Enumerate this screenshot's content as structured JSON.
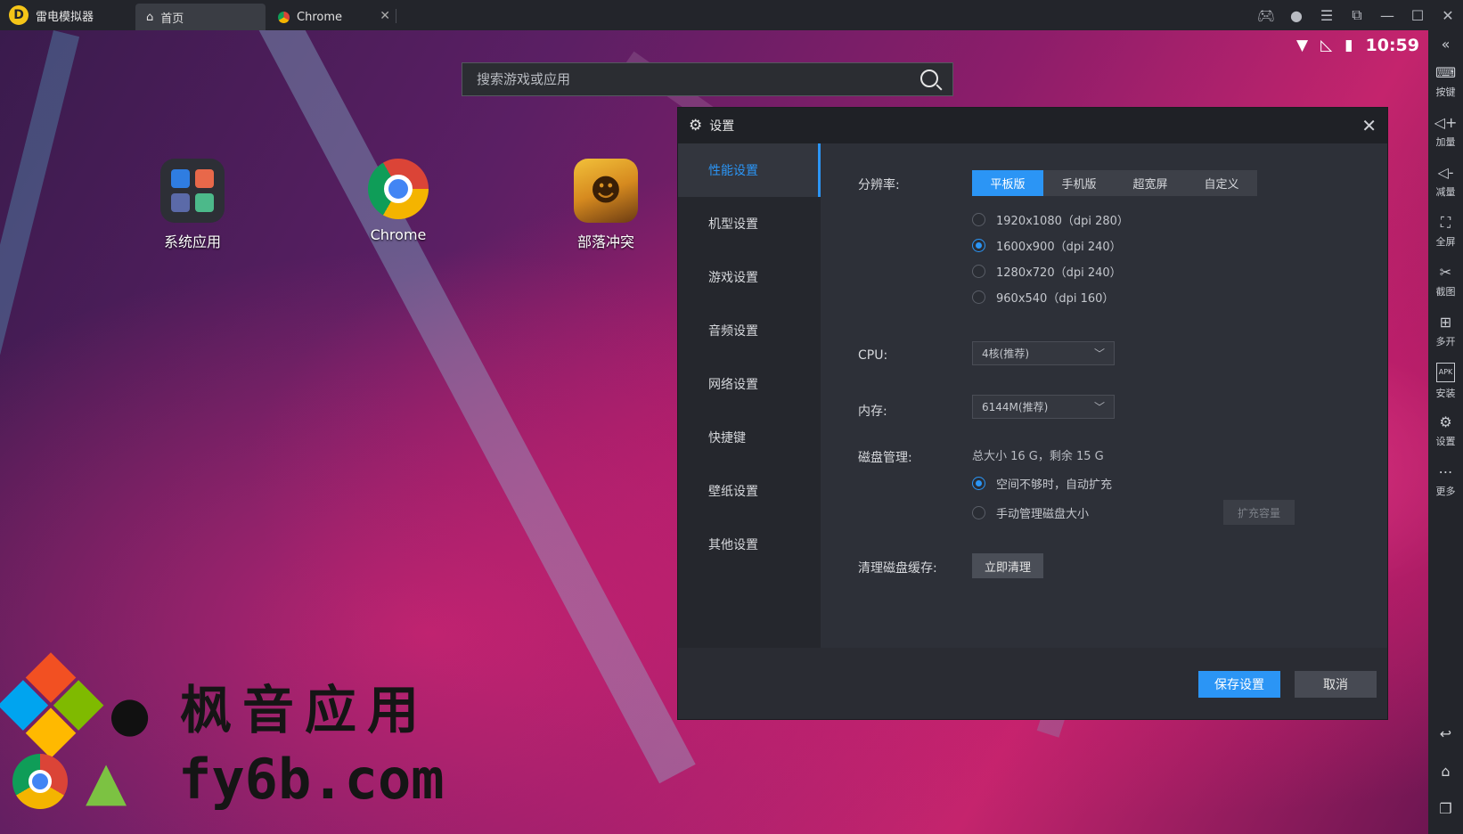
{
  "app": {
    "name": "雷电模拟器",
    "logo_icon": "lightning-logo-icon"
  },
  "tabs": [
    {
      "label": "首页",
      "icon": "home-icon"
    },
    {
      "label": "Chrome",
      "icon": "chrome-icon"
    }
  ],
  "window_controls": [
    "gamepad-icon",
    "user-icon",
    "menu-icon",
    "pip-icon",
    "minimize-icon",
    "maximize-icon",
    "close-icon"
  ],
  "status": {
    "time": "10:59"
  },
  "search": {
    "placeholder": "搜索游戏或应用"
  },
  "desktop_apps": [
    {
      "label": "系统应用"
    },
    {
      "label": "Chrome"
    },
    {
      "label": "部落冲突"
    }
  ],
  "watermark": {
    "line1": "枫音应用",
    "line2": "fy6b.com"
  },
  "sidebar": {
    "items": [
      {
        "label": "按键",
        "icon": "keyboard-icon"
      },
      {
        "label": "加量",
        "icon": "volume-up-icon"
      },
      {
        "label": "减量",
        "icon": "volume-down-icon"
      },
      {
        "label": "全屏",
        "icon": "fullscreen-icon"
      },
      {
        "label": "截图",
        "icon": "scissors-icon"
      },
      {
        "label": "多开",
        "icon": "multi-instance-icon"
      },
      {
        "label": "安装",
        "icon": "apk-icon"
      },
      {
        "label": "设置",
        "icon": "gear-icon"
      },
      {
        "label": "更多",
        "icon": "more-icon"
      }
    ]
  },
  "dialog": {
    "title": "设置",
    "nav": [
      "性能设置",
      "机型设置",
      "游戏设置",
      "音频设置",
      "网络设置",
      "快捷键",
      "壁纸设置",
      "其他设置"
    ],
    "active_nav": "性能设置",
    "resolution": {
      "label": "分辨率:",
      "modes": [
        "平板版",
        "手机版",
        "超宽屏",
        "自定义"
      ],
      "selected_mode": "平板版",
      "options": [
        "1920x1080（dpi 280）",
        "1600x900（dpi 240）",
        "1280x720（dpi 240）",
        "960x540（dpi 160）"
      ],
      "selected_option": "1600x900（dpi 240）"
    },
    "cpu": {
      "label": "CPU:",
      "value": "4核(推荐)"
    },
    "memory": {
      "label": "内存:",
      "value": "6144M(推荐)"
    },
    "disk": {
      "label": "磁盘管理:",
      "info": "总大小 16 G，剩余 15 G",
      "options": [
        "空间不够时，自动扩充",
        "手动管理磁盘大小"
      ],
      "selected_option": "空间不够时，自动扩充",
      "expand_button": "扩充容量"
    },
    "cache": {
      "label": "清理磁盘缓存:",
      "button": "立即清理"
    },
    "footer": {
      "save": "保存设置",
      "cancel": "取消"
    },
    "accent_color": "#2b95f5"
  }
}
